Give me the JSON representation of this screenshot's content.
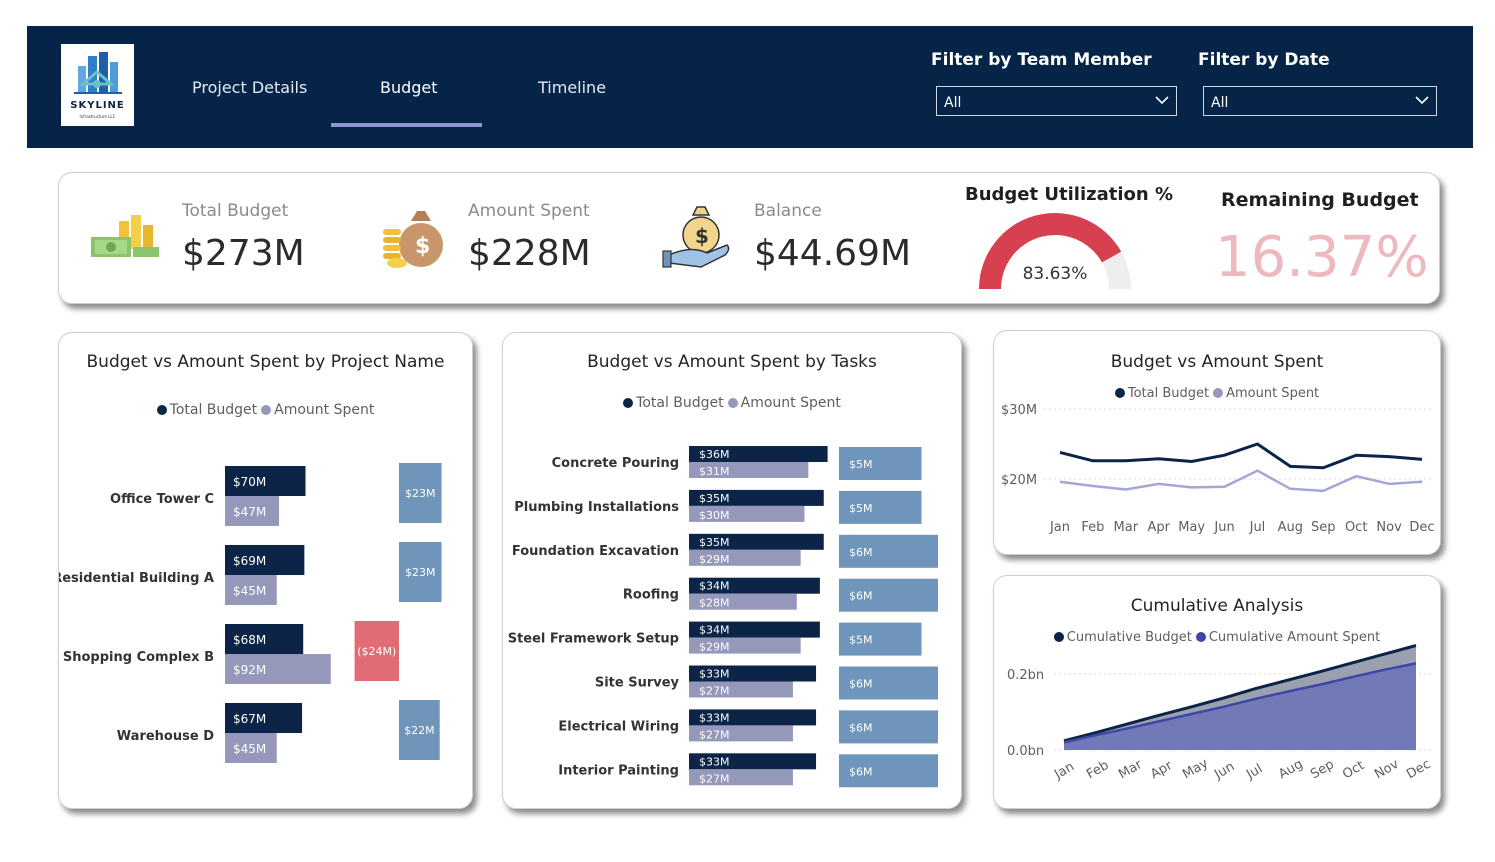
{
  "brand": {
    "name": "SKYLINE",
    "sub": "Infrastructure LLC"
  },
  "nav": {
    "tabs": [
      {
        "label": "Project Details"
      },
      {
        "label": "Budget"
      },
      {
        "label": "Timeline"
      }
    ],
    "active": "Budget"
  },
  "filters": {
    "team_member": {
      "label": "Filter by Team Member",
      "value": "All"
    },
    "date": {
      "label": "Filter by Date",
      "value": "All"
    }
  },
  "kpis": {
    "total_budget": {
      "label": "Total Budget",
      "value": "$273M",
      "icon": "money-stack-icon"
    },
    "amount_spent": {
      "label": "Amount Spent",
      "value": "$228M",
      "icon": "money-bag-coins-icon"
    },
    "balance": {
      "label": "Balance",
      "value": "$44.69M",
      "icon": "hand-money-bag-icon"
    },
    "utilization": {
      "label": "Budget Utilization %",
      "value_text": "83.63%",
      "value": 0.8363
    },
    "remaining": {
      "label": "Remaining Budget",
      "value": "16.37%"
    }
  },
  "colors": {
    "navy": "#052448",
    "budget": "#0b2447",
    "spent": "#9598bb",
    "variance": "#6f95ba",
    "negative": "#e06c75",
    "gauge": "#d6404f",
    "remaining": "#eeb8bf",
    "cum_spent": "#3f46a8"
  },
  "chart_data": [
    {
      "id": "by_project",
      "type": "bar",
      "title": "Budget vs Amount Spent by Project Name",
      "legend": [
        "Total Budget",
        "Amount Spent"
      ],
      "categories": [
        "Office Tower C",
        "Residential Building A",
        "Shopping Complex B",
        "Warehouse D"
      ],
      "series": [
        {
          "name": "Total Budget",
          "values": [
            70,
            69,
            68,
            67
          ],
          "labels": [
            "$70M",
            "$69M",
            "$68M",
            "$67M"
          ]
        },
        {
          "name": "Amount Spent",
          "values": [
            47,
            45,
            92,
            45
          ],
          "labels": [
            "$47M",
            "$45M",
            "$92M",
            "$45M"
          ]
        }
      ],
      "variance": {
        "values": [
          23,
          23,
          -24,
          22
        ],
        "labels": [
          "$23M",
          "$23M",
          "($24M)",
          "$22M"
        ]
      }
    },
    {
      "id": "by_tasks",
      "type": "bar",
      "title": "Budget vs Amount Spent by Tasks",
      "legend": [
        "Total Budget",
        "Amount Spent"
      ],
      "categories": [
        "Concrete Pouring",
        "Plumbing Installations",
        "Foundation Excavation",
        "Roofing",
        "Steel Framework Setup",
        "Site Survey",
        "Electrical Wiring",
        "Interior Painting"
      ],
      "series": [
        {
          "name": "Total Budget",
          "values": [
            36,
            35,
            35,
            34,
            34,
            33,
            33,
            33
          ],
          "labels": [
            "$36M",
            "$35M",
            "$35M",
            "$34M",
            "$34M",
            "$33M",
            "$33M",
            "$33M"
          ]
        },
        {
          "name": "Amount Spent",
          "values": [
            31,
            30,
            29,
            28,
            29,
            27,
            27,
            27
          ],
          "labels": [
            "$31M",
            "$30M",
            "$29M",
            "$28M",
            "$29M",
            "$27M",
            "$27M",
            "$27M"
          ]
        }
      ],
      "variance": {
        "values": [
          5,
          5,
          6,
          6,
          5,
          6,
          6,
          6
        ],
        "labels": [
          "$5M",
          "$5M",
          "$6M",
          "$6M",
          "$5M",
          "$6M",
          "$6M",
          "$6M"
        ]
      }
    },
    {
      "id": "monthly",
      "type": "line",
      "title": "Budget vs Amount Spent",
      "legend": [
        "Total Budget",
        "Amount Spent"
      ],
      "x": [
        "Jan",
        "Feb",
        "Mar",
        "Apr",
        "May",
        "Jun",
        "Jul",
        "Aug",
        "Sep",
        "Oct",
        "Nov",
        "Dec"
      ],
      "ylim": [
        16,
        32
      ],
      "yticks": [
        {
          "v": 20,
          "label": "$20M"
        },
        {
          "v": 30,
          "label": "$30M"
        }
      ],
      "series": [
        {
          "name": "Total Budget",
          "values": [
            23.8,
            22.6,
            22.6,
            22.9,
            22.5,
            23.4,
            25.0,
            21.8,
            21.6,
            23.4,
            23.2,
            22.8
          ]
        },
        {
          "name": "Amount Spent",
          "values": [
            19.6,
            19.0,
            18.5,
            19.3,
            18.8,
            18.9,
            21.2,
            18.6,
            18.3,
            20.4,
            19.3,
            19.6
          ]
        }
      ]
    },
    {
      "id": "cumulative",
      "type": "area",
      "title": "Cumulative Analysis",
      "legend": [
        "Cumulative Budget",
        "Cumulative Amount Spent"
      ],
      "x": [
        "Jan",
        "Feb",
        "Mar",
        "Apr",
        "May",
        "Jun",
        "Jul",
        "Aug",
        "Sep",
        "Oct",
        "Nov",
        "Dec"
      ],
      "ylim": [
        0,
        0.3
      ],
      "yticks": [
        {
          "v": 0,
          "label": "0.0bn"
        },
        {
          "v": 0.2,
          "label": "0.2bn"
        }
      ],
      "series": [
        {
          "name": "Cumulative Budget",
          "values": [
            0.024,
            0.046,
            0.069,
            0.092,
            0.114,
            0.137,
            0.162,
            0.184,
            0.206,
            0.229,
            0.252,
            0.275
          ]
        },
        {
          "name": "Cumulative Amount Spent",
          "values": [
            0.02,
            0.039,
            0.057,
            0.076,
            0.095,
            0.114,
            0.135,
            0.154,
            0.172,
            0.192,
            0.211,
            0.228
          ]
        }
      ]
    }
  ]
}
